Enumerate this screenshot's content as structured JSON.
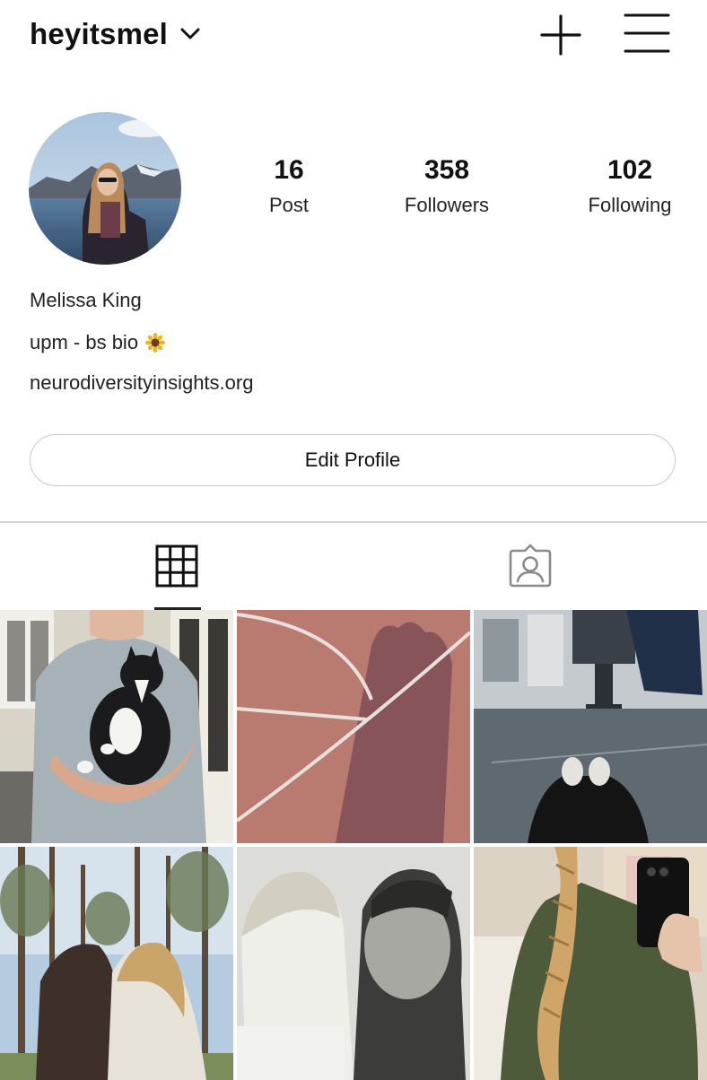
{
  "header": {
    "username": "heyitsmel",
    "icons": {
      "dropdown": "chevron-down-icon",
      "new_post": "plus-icon",
      "menu": "hamburger-menu-icon"
    }
  },
  "profile": {
    "stats": [
      {
        "value": "16",
        "label": "Post"
      },
      {
        "value": "358",
        "label": "Followers"
      },
      {
        "value": "102",
        "label": "Following"
      }
    ],
    "display_name": "Melissa King",
    "bio": "upm - bs bio",
    "bio_emoji": "sunflower",
    "website": "neurodiversityinsights.org",
    "edit_button_label": "Edit Profile"
  },
  "tabs": {
    "items": [
      {
        "icon": "grid-icon",
        "selected": true
      },
      {
        "icon": "tagged-person-icon",
        "selected": false
      }
    ]
  },
  "colors": {
    "divider": "#d7cfdc",
    "text": "#111111",
    "button_border": "#c9c9c9"
  }
}
